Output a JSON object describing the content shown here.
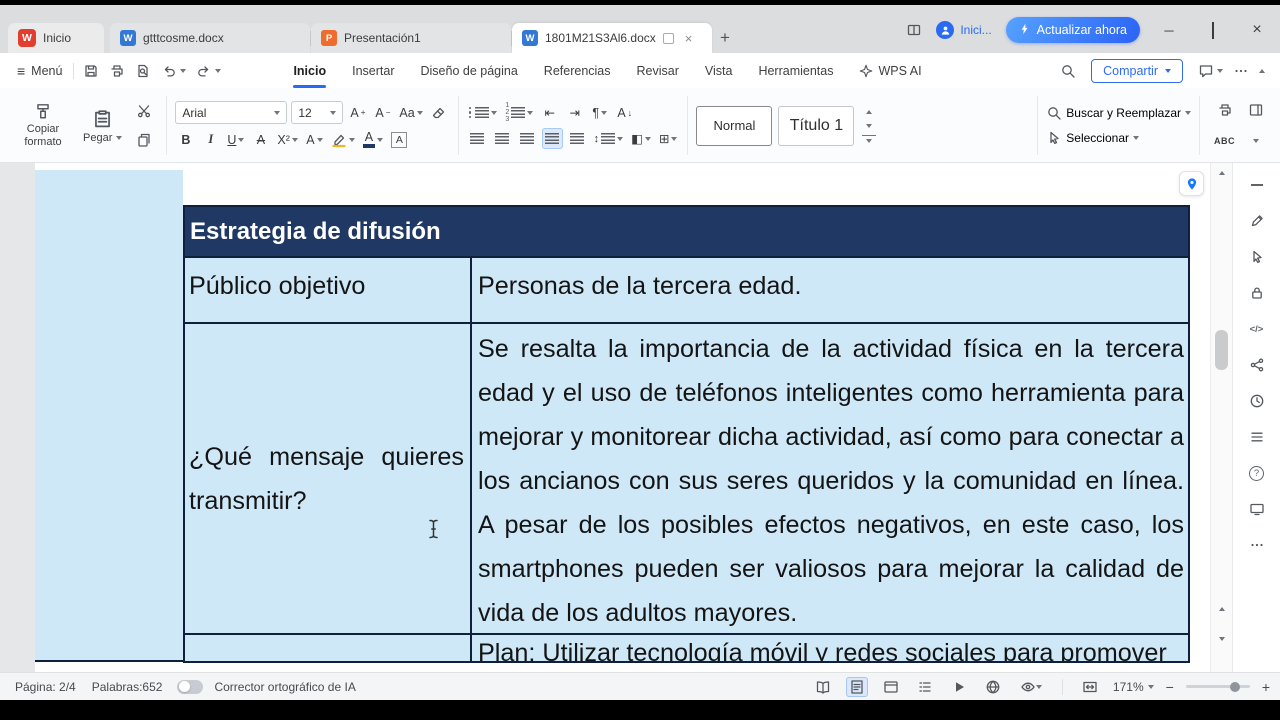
{
  "titlebar": {
    "home_label": "Inicio",
    "tab1": "gtttcosme.docx",
    "tab2": "Presentación1",
    "tab3": "1801M21S3Al6.docx",
    "user_label": "Inici...",
    "update_label": "Actualizar ahora"
  },
  "menubar": {
    "menu_label": "Menú",
    "tabs": [
      "Inicio",
      "Insertar",
      "Diseño de página",
      "Referencias",
      "Revisar",
      "Vista",
      "Herramientas",
      "WPS AI"
    ],
    "share_label": "Compartir"
  },
  "ribbon": {
    "copy_format_label": "Copiar formato",
    "paste_label": "Pegar",
    "font_name": "Arial",
    "font_size": "12",
    "style_1": "Normal",
    "style_2": "Título 1",
    "find_label": "Buscar y Reemplazar",
    "select_label": "Seleccionar",
    "spell_label": "ABC"
  },
  "glyphs": {
    "menu": "≡",
    "plus": "+",
    "minimize": "─",
    "close": "×",
    "bold": "B",
    "italic": "I",
    "underline": "U",
    "letter_a": "A",
    "case": "Aa",
    "superscript": "X²",
    "sup_plus": "+",
    "sup_minus": "−",
    "paragraph": "¶",
    "outdent": "⇤",
    "indent": "⇥",
    "updown": "↕",
    "arrow_down": "↓",
    "shading": "◧",
    "borders": "⊞",
    "code": "</>",
    "question": "?",
    "minus": "−"
  },
  "document": {
    "table": {
      "title": "Estrategia de difusión",
      "rows": [
        {
          "label": "Público objetivo",
          "value": "Personas de la tercera edad."
        },
        {
          "label": "¿Qué mensaje quieres transmitir?",
          "value": "Se resalta la importancia de la actividad física en la tercera edad y el uso de teléfonos inteligentes como herramienta para mejorar y monitorear dicha actividad, así como para conectar a los ancianos con sus seres queridos y la comunidad en línea. A pesar de los posibles efectos negativos, en este caso, los smartphones pueden ser valiosos para mejorar la calidad de vida de los adultos mayores."
        },
        {
          "label": "",
          "value": "Plan: Utilizar tecnología móvil y redes sociales para promover"
        }
      ]
    },
    "colors": {
      "header_bg": "#1f3864",
      "cell_bg": "#cfe8f7",
      "border": "#101f3c"
    }
  },
  "sidebar": {
    "icons": [
      "collapse",
      "edit-pen",
      "cursor-select",
      "lock",
      "source-code",
      "share",
      "history",
      "navigation-list",
      "help",
      "screen-cast",
      "more"
    ]
  },
  "statusbar": {
    "page_label": "Página: 2/4",
    "words_label": "Palabras:652",
    "spell_toggle_label": "Corrector ortográfico de IA",
    "zoom_level": "171%"
  },
  "colors": {
    "accent_blue": "#2a6af2"
  }
}
